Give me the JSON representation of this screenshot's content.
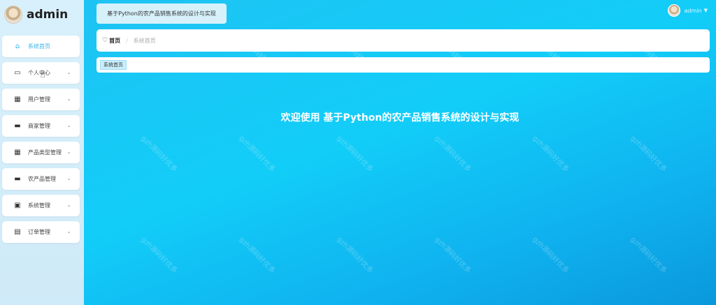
{
  "sidebar": {
    "brand": "admin",
    "items": [
      {
        "label": "系统首页",
        "icon": "home-icon",
        "glyph": "⌂",
        "active": true,
        "has_chevron": false
      },
      {
        "label": "个人中心",
        "icon": "card-icon",
        "glyph": "▭",
        "active": false,
        "has_chevron": true
      },
      {
        "label": "用户管理",
        "icon": "grid-icon",
        "glyph": "▦",
        "active": false,
        "has_chevron": true
      },
      {
        "label": "商家管理",
        "icon": "briefcase-icon",
        "glyph": "▬",
        "active": false,
        "has_chevron": true
      },
      {
        "label": "产品类型管理",
        "icon": "grid-icon",
        "glyph": "▦",
        "active": false,
        "has_chevron": true
      },
      {
        "label": "农产品管理",
        "icon": "chat-icon",
        "glyph": "▬",
        "active": false,
        "has_chevron": true
      },
      {
        "label": "系统管理",
        "icon": "clipboard-check-icon",
        "glyph": "▣",
        "active": false,
        "has_chevron": true
      },
      {
        "label": "订单管理",
        "icon": "clipboard-icon",
        "glyph": "▤",
        "active": false,
        "has_chevron": true
      }
    ]
  },
  "header": {
    "title": "基于Python的农产品销售系统的设计与实现",
    "user_name": "admin"
  },
  "breadcrumb": {
    "home": "首页",
    "current": "系统首页"
  },
  "tags": {
    "active_tag": "系统首页"
  },
  "main": {
    "welcome": "欢迎使用 基于Python的农产品销售系统的设计与实现"
  },
  "watermark": "gzh源码好优多",
  "colors": {
    "accent": "#36b6e8",
    "main_bg": "#12cdf8",
    "sidebar_bg": "#d8f0fb"
  }
}
